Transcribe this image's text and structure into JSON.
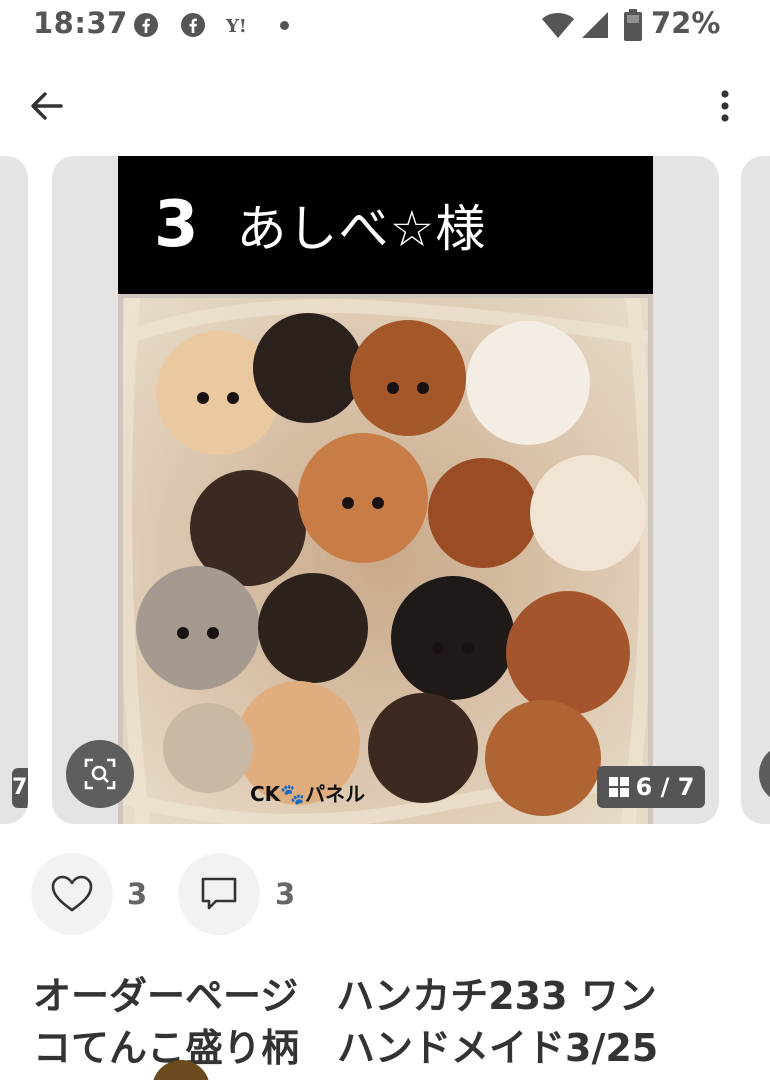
{
  "status_bar": {
    "time": "18:37",
    "battery_percent": "72%",
    "icons": [
      "facebook-icon",
      "facebook-icon",
      "yahoo-icon",
      "notification-dot-icon",
      "wifi-icon",
      "signal-icon",
      "battery-icon"
    ]
  },
  "top_bar": {
    "back_icon": "arrow-left-icon",
    "more_icon": "more-vertical-icon"
  },
  "carousel": {
    "left_peek_counter": "7",
    "image_header_number": "3",
    "image_header_text": "あしべ☆様",
    "watermark": "CK🐾パネル",
    "page_counter": "6 / 7",
    "current_page": 6,
    "total_pages": 7,
    "zoom_icon": "zoom-search-icon",
    "grid_icon": "grid-icon"
  },
  "actions": {
    "like_count": "3",
    "comment_count": "3"
  },
  "product": {
    "title": "オーダーページ　ハンカチ233 ワン\nコてんこ盛り柄　ハンドメイド3/25"
  },
  "colors": {
    "status_text": "#555555",
    "card_bg": "#e4e4e4",
    "action_bg": "#f2f2f2",
    "overlay_bg": "#555555"
  }
}
